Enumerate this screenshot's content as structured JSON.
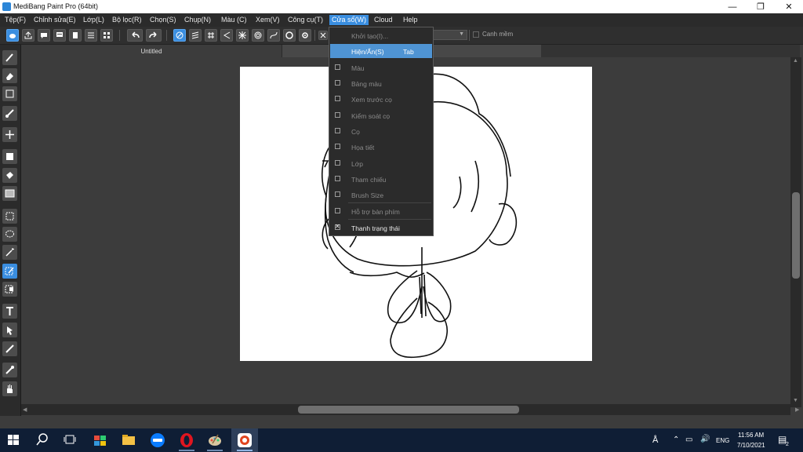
{
  "window": {
    "title": "MediBang Paint Pro (64bit)"
  },
  "menubar": [
    {
      "label": "Tệp(F)",
      "active": false
    },
    {
      "label": "Chỉnh sửa(E)",
      "active": false
    },
    {
      "label": "Lớp(L)",
      "active": false
    },
    {
      "label": "Bộ lọc(R)",
      "active": false
    },
    {
      "label": "Chọn(S)",
      "active": false
    },
    {
      "label": "Chụp(N)",
      "active": false
    },
    {
      "label": "Màu (C)",
      "active": false
    },
    {
      "label": "Xem(V)",
      "active": false
    },
    {
      "label": "Công cụ(T)",
      "active": false
    },
    {
      "label": "Cửa sổ(W)",
      "active": true
    },
    {
      "label": "Cloud",
      "active": false
    },
    {
      "label": "Help",
      "active": false
    }
  ],
  "toolbar": {
    "smoothing_label": "Canh mềm"
  },
  "document": {
    "tab_title": "Untitled"
  },
  "window_menu": {
    "items": [
      {
        "label": "Khởi tạo(I)...",
        "check": "none",
        "state": "normal"
      },
      {
        "label": "Hiện/Ẩn(S)",
        "shortcut": "Tab",
        "check": "none",
        "state": "highlight"
      },
      {
        "label": "Màu",
        "check": "empty",
        "state": "normal"
      },
      {
        "label": "Bảng màu",
        "check": "empty",
        "state": "normal"
      },
      {
        "label": "Xem trước cọ",
        "check": "empty",
        "state": "normal"
      },
      {
        "label": "Kiểm soát cọ",
        "check": "empty",
        "state": "normal"
      },
      {
        "label": "Cọ",
        "check": "empty",
        "state": "normal"
      },
      {
        "label": "Họa tiết",
        "check": "empty",
        "state": "normal"
      },
      {
        "label": "Lớp",
        "check": "empty",
        "state": "normal"
      },
      {
        "label": "Tham chiếu",
        "check": "empty",
        "state": "normal"
      },
      {
        "label": "Brush Size",
        "check": "empty",
        "state": "normal"
      },
      {
        "label": "Hỗ trợ bàn phím",
        "check": "empty",
        "state": "normal"
      },
      {
        "label": "Thanh trạng thái",
        "check": "checked",
        "state": "checked"
      }
    ]
  },
  "taskbar": {
    "time": "11:56 AM",
    "date": "7/10/2021",
    "language": "ENG",
    "notification_count": "2"
  }
}
